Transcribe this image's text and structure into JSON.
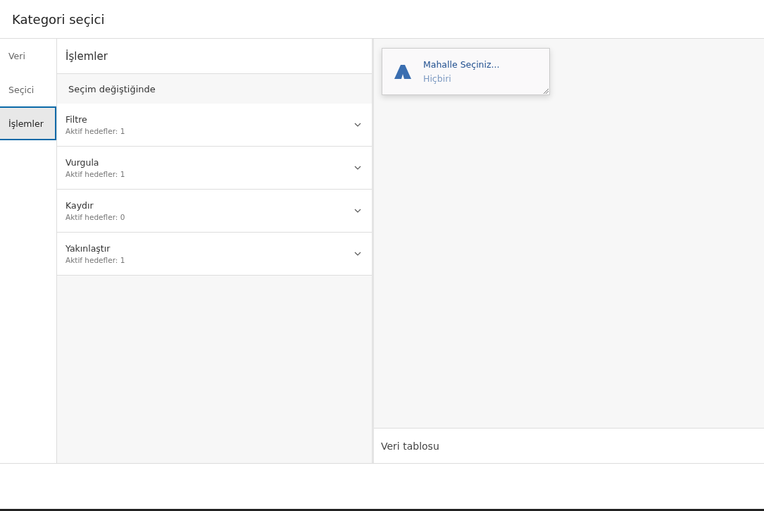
{
  "header": {
    "title": "Kategori seçici"
  },
  "tabs": [
    {
      "label": "Veri",
      "selected": false
    },
    {
      "label": "Seçici",
      "selected": false
    },
    {
      "label": "İşlemler",
      "selected": true
    }
  ],
  "panel": {
    "title": "İşlemler",
    "section": "Seçim değiştiğinde",
    "actions": [
      {
        "name": "Filtre",
        "detail": "Aktif hedefler: 1",
        "expanded": false
      },
      {
        "name": "Vurgula",
        "detail": "Aktif hedefler: 1",
        "expanded": false
      },
      {
        "name": "Kaydır",
        "detail": "Aktif hedefler: 0",
        "expanded": false
      },
      {
        "name": "Yakınlaştır",
        "detail": "Aktif hedefler: 1",
        "expanded": false
      }
    ]
  },
  "widget": {
    "title": "Mahalle Seçiniz...",
    "value": "Hiçbiri"
  },
  "data_table": {
    "title": "Veri tablosu"
  }
}
